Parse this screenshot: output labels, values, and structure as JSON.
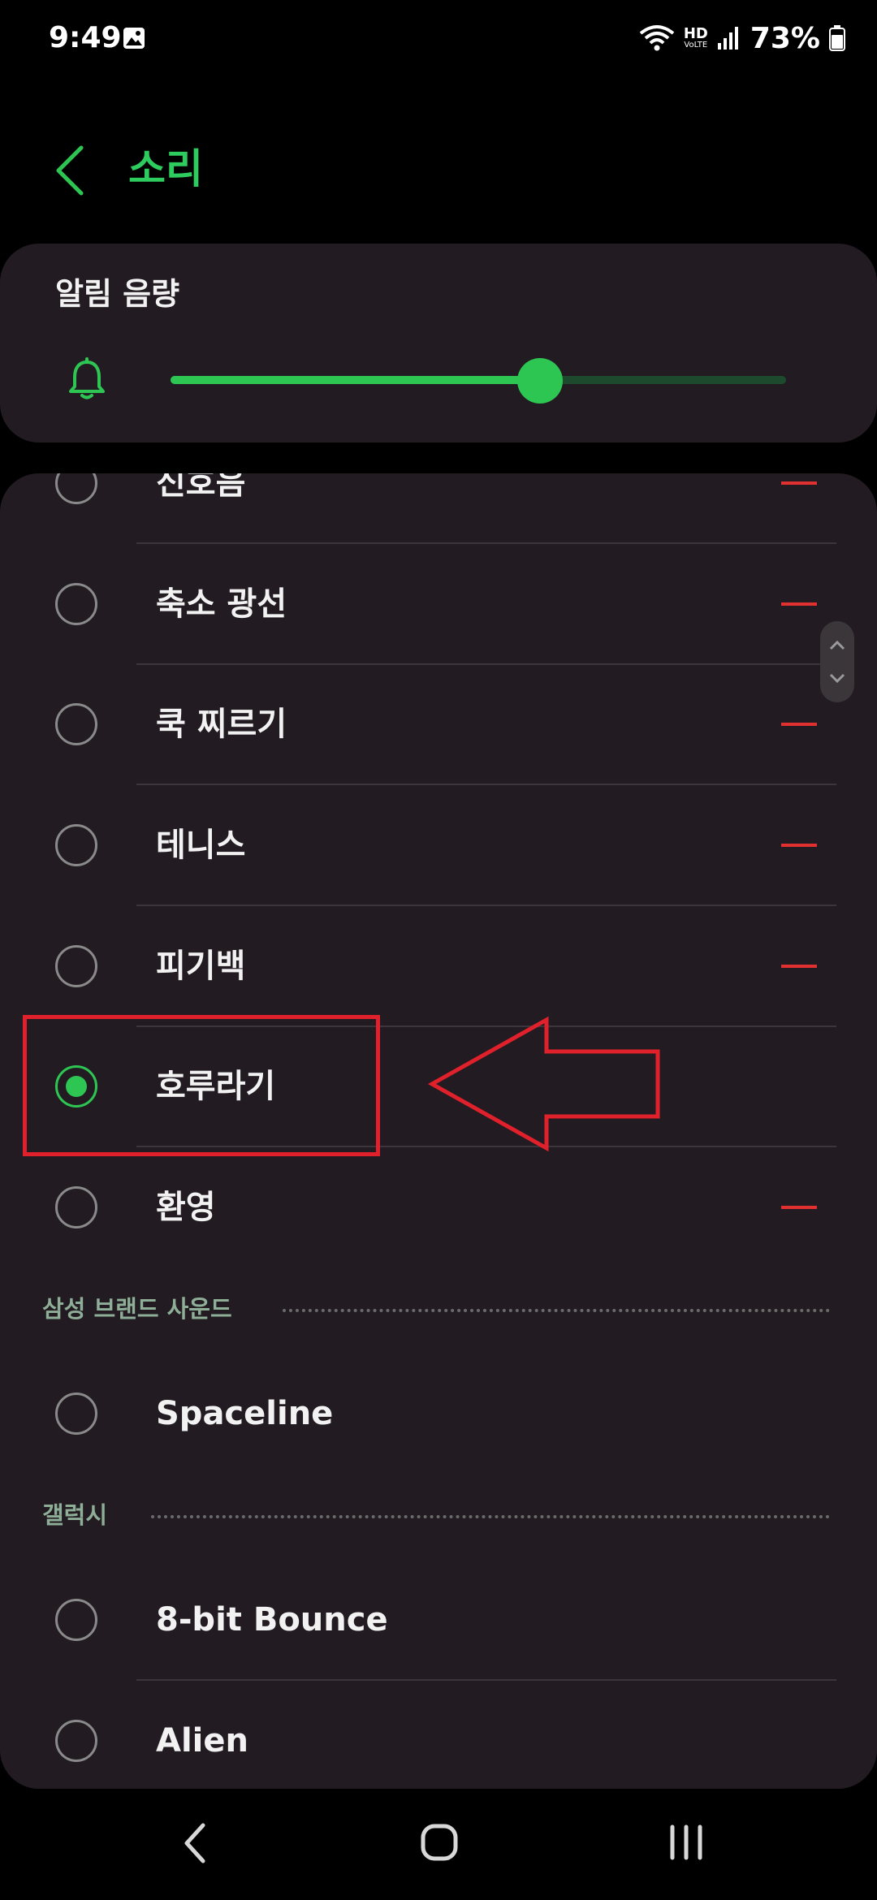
{
  "status_bar": {
    "time": "9:49",
    "hd_label": "HD",
    "voice_label": "VoLTE",
    "battery": "73%",
    "icons": [
      "gallery-icon",
      "wifi-icon",
      "signal-icon",
      "battery-icon"
    ]
  },
  "header": {
    "title": "소리",
    "back_icon": "chevron-left-icon"
  },
  "volume": {
    "title": "알림 음량",
    "icon": "bell-icon",
    "level": 0.6
  },
  "list": {
    "items": [
      {
        "label": "신호음",
        "selected": false,
        "has_dash": true
      },
      {
        "label": "축소 광선",
        "selected": false,
        "has_dash": true
      },
      {
        "label": "쿡 찌르기",
        "selected": false,
        "has_dash": true
      },
      {
        "label": "테니스",
        "selected": false,
        "has_dash": true
      },
      {
        "label": "피기백",
        "selected": false,
        "has_dash": true
      },
      {
        "label": "호루라기",
        "selected": true,
        "has_dash": false
      },
      {
        "label": "환영",
        "selected": false,
        "has_dash": true
      }
    ],
    "sections": [
      {
        "title": "삼성 브랜드 사운드",
        "items": [
          {
            "label": "Spaceline",
            "selected": false
          }
        ]
      },
      {
        "title": "갤럭시",
        "items": [
          {
            "label": "8-bit Bounce",
            "selected": false
          },
          {
            "label": "Alien",
            "selected": false
          }
        ]
      }
    ]
  },
  "colors": {
    "accent": "#2ec653",
    "title": "#2ecc5f",
    "card": "#221c22",
    "annotation": "#e0202a",
    "dash": "#e03030"
  },
  "nav": {
    "icons": [
      "nav-back-icon",
      "nav-home-icon",
      "nav-recent-icon"
    ]
  }
}
